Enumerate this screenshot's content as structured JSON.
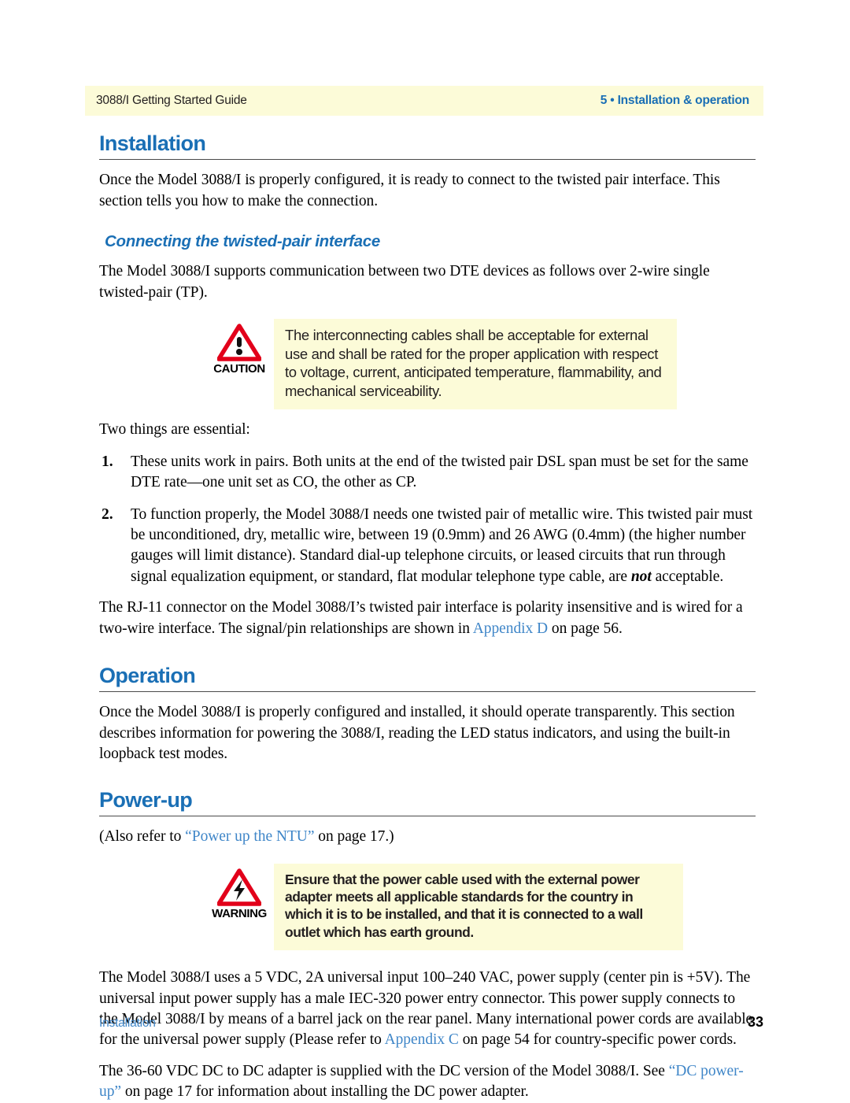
{
  "header": {
    "left": "3088/I Getting Started Guide",
    "right": "5 • Installation & operation",
    "bar_color": "#fcfbd8",
    "accent_color": "#1a6fb5"
  },
  "sections": {
    "installation": {
      "title": "Installation",
      "intro": "Once the Model 3088/I is properly configured, it is ready to connect to the twisted pair interface. This section tells you how to make the connection.",
      "subhead": "Connecting the twisted-pair interface",
      "subhead_para": "The Model 3088/I supports communication between two DTE devices as follows over 2-wire single twisted-pair (TP).",
      "caution": {
        "label": "CAUTION",
        "icon": "warning-triangle-exclamation-icon",
        "text": "The interconnecting cables shall be acceptable for external use and shall be rated for the proper application with respect to voltage, current, anticipated temperature, flammability, and mechanical serviceability."
      },
      "lead_in": "Two things are essential:",
      "list": [
        {
          "num": "1.",
          "text": "These units work in pairs. Both units at the end of the twisted pair DSL span must be set for the same DTE rate—one unit set as CO, the other as CP."
        },
        {
          "num": "2.",
          "text_a": "To function properly, the Model 3088/I needs one twisted pair of metallic wire. This twisted pair must be unconditioned, dry, metallic wire, between 19 (0.9mm) and 26 AWG (0.4mm) (the higher number gauges will limit distance). Standard dial-up telephone circuits, or leased circuits that run through signal equalization equipment, or standard, flat modular telephone type cable, are ",
          "emphasis": "not",
          "text_b": " acceptable."
        }
      ],
      "closing_a": "The RJ-11 connector on the Model 3088/I’s twisted pair interface is polarity insensitive and is wired for a two-wire interface. The signal/pin relationships are shown in ",
      "closing_link": "Appendix D",
      "closing_b": " on page 56."
    },
    "operation": {
      "title": "Operation",
      "intro": "Once the Model 3088/I is properly configured and installed, it should operate transparently. This section describes information for powering the 3088/I, reading the LED status indicators, and using the built-in loopback test modes."
    },
    "powerup": {
      "title": "Power-up",
      "refer_a": "(Also refer to ",
      "refer_link": "“Power up the NTU”",
      "refer_b": " on page 17.)",
      "warning": {
        "label": "WARNING",
        "icon": "warning-triangle-lightning-icon",
        "text": "Ensure that the power cable used with the external power adapter meets all applicable standards for the country in which it is to be installed, and that it is connected to a wall outlet which has earth ground."
      },
      "para1_a": "The Model 3088/I uses a 5 VDC, 2A universal input 100–240 VAC, power supply (center pin is +5V). The universal input power supply has a male IEC-320 power entry connector. This power supply connects to the Model 3088/I by means of a barrel jack on the rear panel. Many international power cords are available for the universal power supply (Please refer to ",
      "para1_link": "Appendix C",
      "para1_b": " on page 54 for country-specific power cords.",
      "para2_a": "The 36-60 VDC DC to DC adapter is supplied with the DC version of the Model 3088/I. See ",
      "para2_link": "“DC power-up”",
      "para2_b": " on page 17 for information about installing the DC power adapter."
    }
  },
  "footer": {
    "left": "Installation",
    "page_number": "33"
  }
}
